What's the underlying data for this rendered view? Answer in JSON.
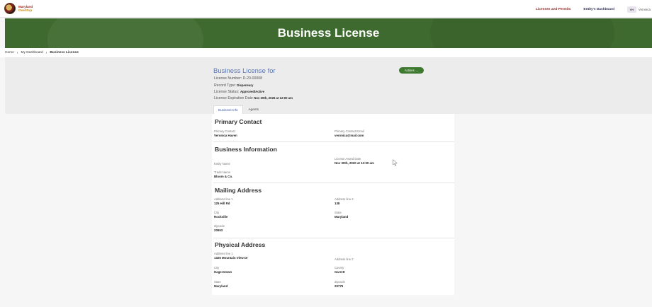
{
  "topbar": {
    "logo_line1": "Maryland",
    "logo_line2": "OneStop",
    "nav": [
      "Licenses and Permits",
      "Entity's Dashboard"
    ],
    "user_initials": "VH",
    "user_name": "Veronica"
  },
  "banner": {
    "title": "Business License"
  },
  "breadcrumb": {
    "items": [
      "Home",
      "My Dashboard"
    ],
    "current": "Business License"
  },
  "license": {
    "title": "Business License for",
    "number": "License Number: D-20-00008",
    "record_type_label": "Record Type:",
    "record_type": "Dispensary",
    "status_label": "License Status:",
    "status": "Approved/Active",
    "expiration_label": "License Expiration Date",
    "expiration": "Nov 30th, 2026 at 12:00 am",
    "actions_label": "Actions"
  },
  "tabs": [
    "Business Info",
    "Agents"
  ],
  "primary_contact": {
    "title": "Primary Contact",
    "contact_label": "Primary Contact",
    "contact_value": "Veronica Haven",
    "email_label": "Primary Contact Email",
    "email_value": "veronica@mail.com"
  },
  "business_info": {
    "title": "Business Information",
    "entity_label": "Entity Name",
    "award_label": "License Award Date",
    "award_value": "Nov 30th, 2020 at 12:00 am",
    "trade_label": "Trade Name",
    "trade_value": "Bloom & Co."
  },
  "mailing": {
    "title": "Mailing Address",
    "addr1_label": "Address line 1",
    "addr1_value": "125 Hill Rd",
    "addr2_label": "Address line 2",
    "addr2_value": "138",
    "city_label": "City",
    "city_value": "Rockville",
    "state_label": "State",
    "state_value": "Maryland",
    "zip_label": "Zipcode",
    "zip_value": "20553"
  },
  "physical": {
    "title": "Physical Address",
    "addr1_label": "Address line 1",
    "addr1_value": "1326 Mountain View Dr",
    "addr2_label": "Address line 2",
    "city_label": "City",
    "city_value": "Hagerstown",
    "county_label": "County",
    "county_value": "Garrett",
    "state_label": "State",
    "state_value": "Maryland",
    "zip_label": "Zipcode",
    "zip_value": "20775"
  },
  "colors": {
    "brand_green": "#3f6a2f",
    "button_green": "#3f7a31",
    "title_blue": "#5a78b4"
  }
}
